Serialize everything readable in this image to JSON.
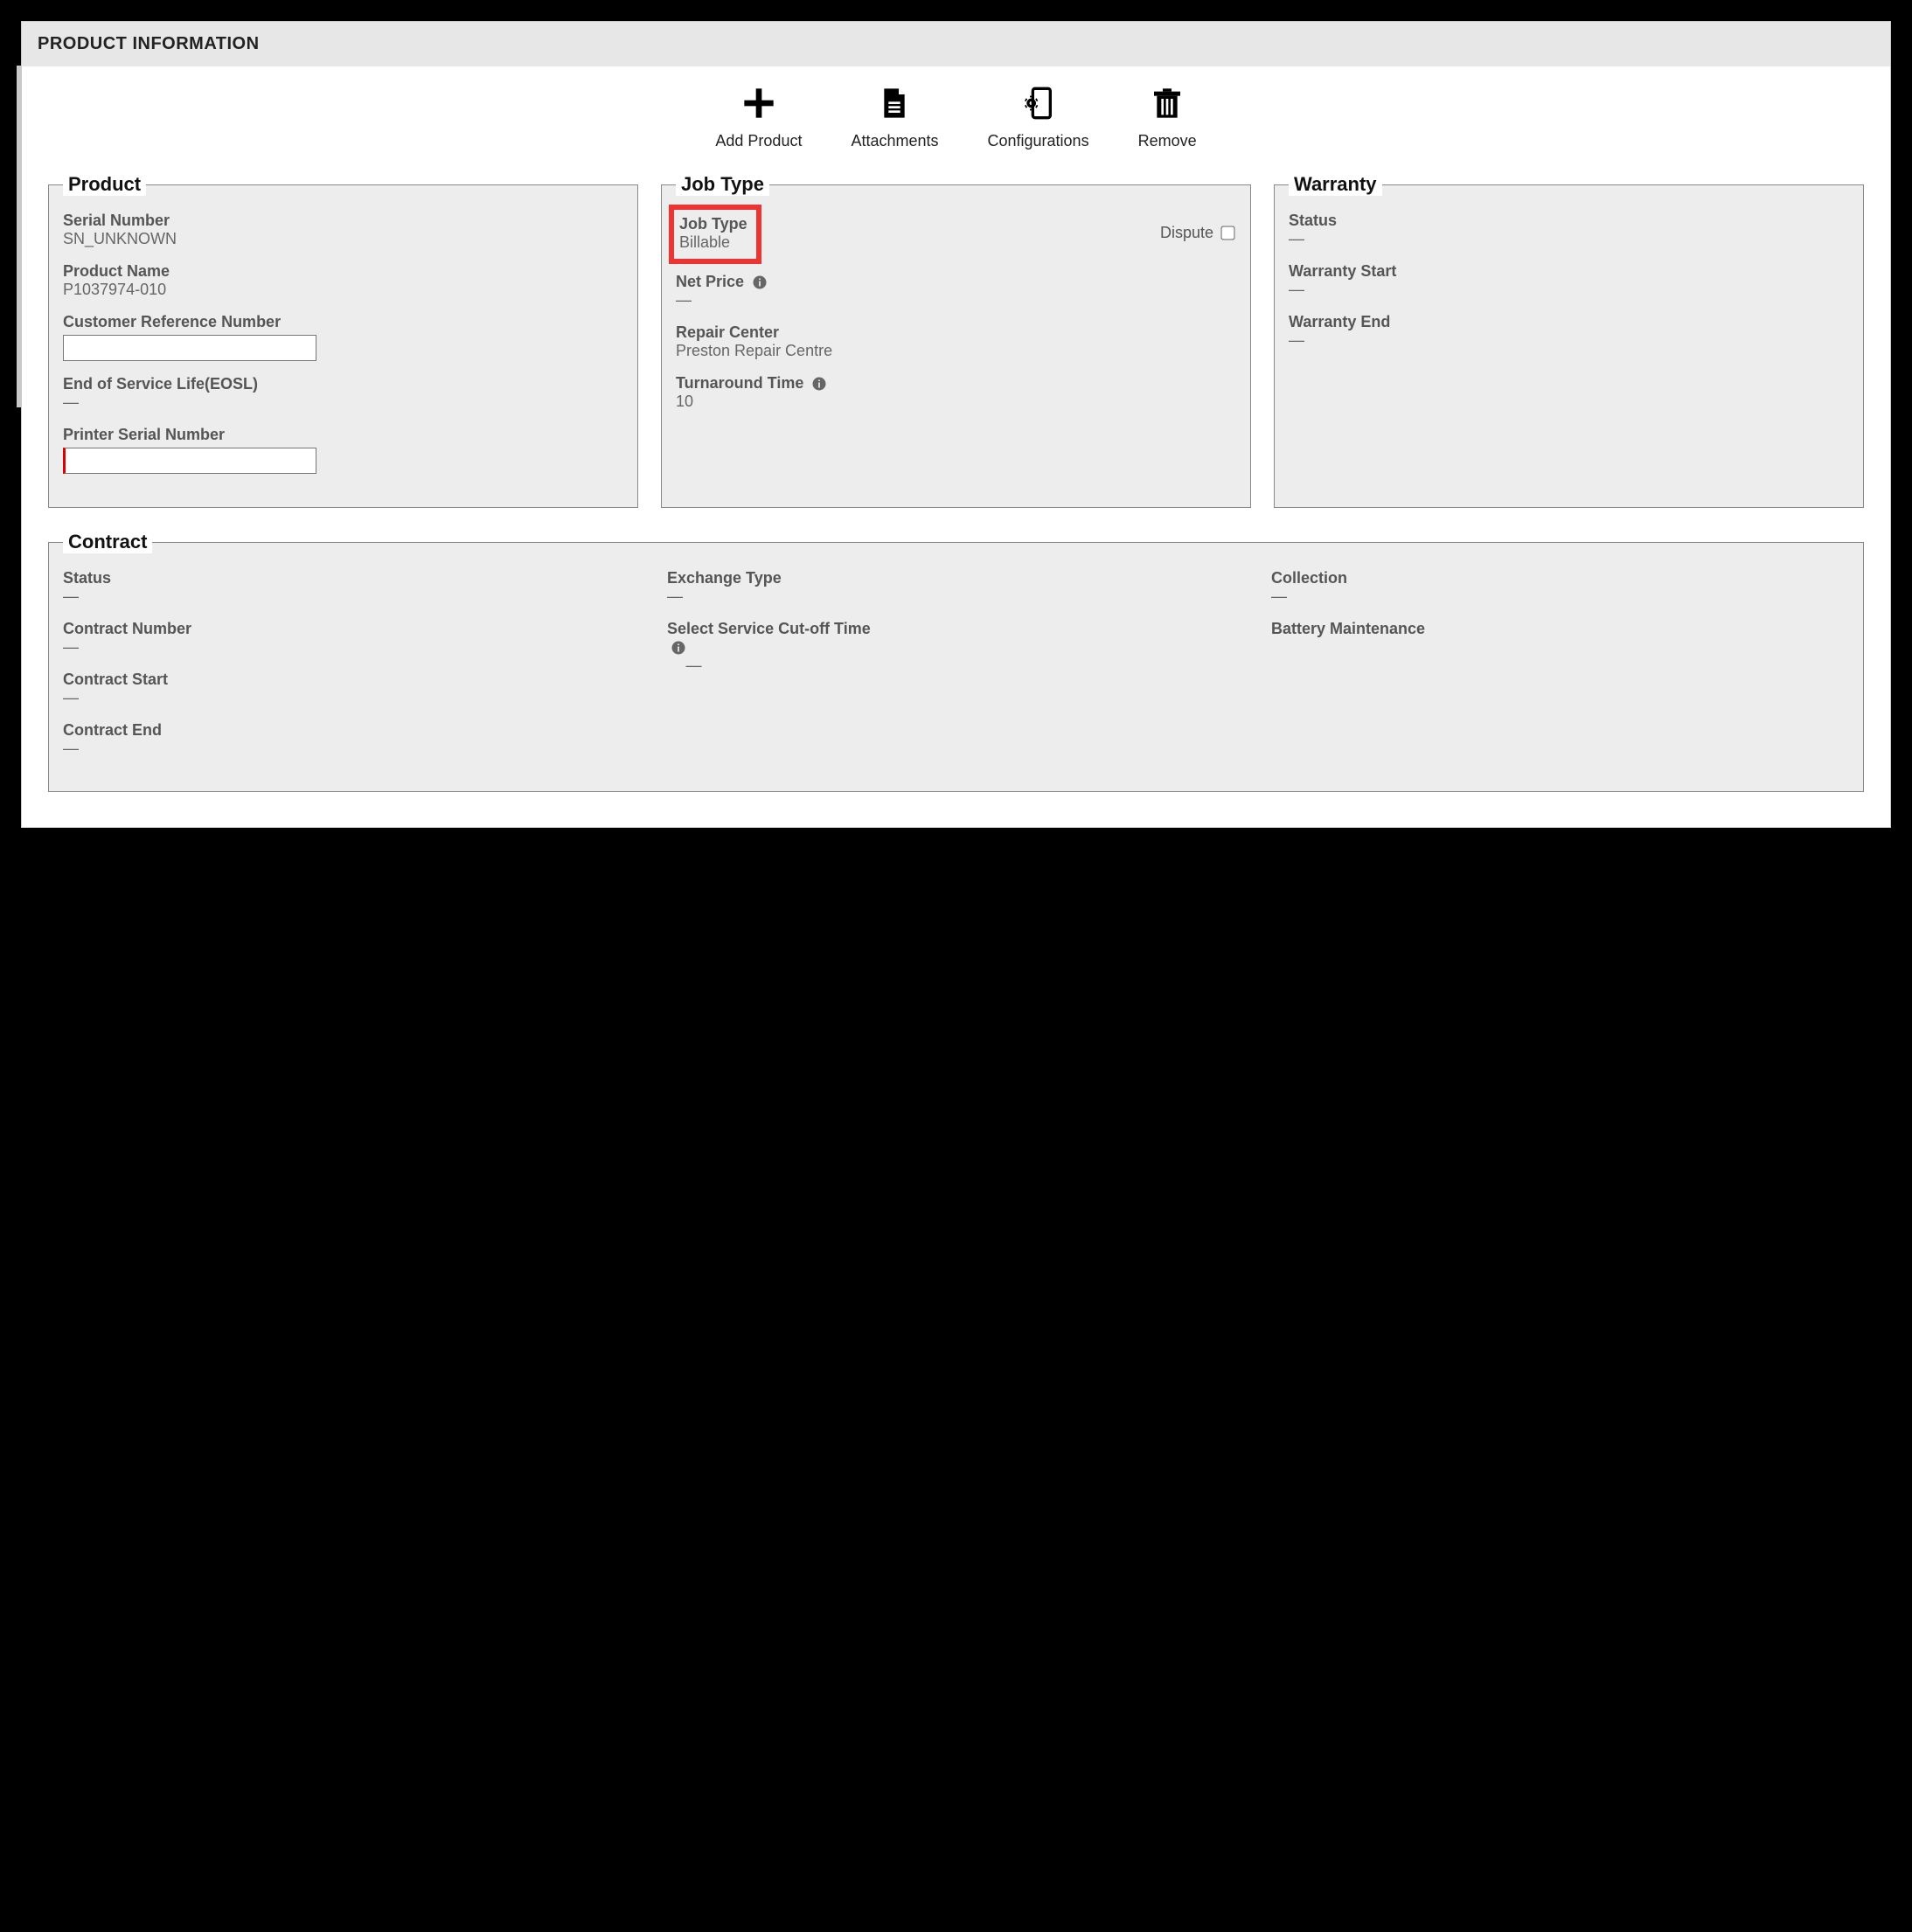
{
  "header": {
    "title": "PRODUCT INFORMATION"
  },
  "toolbar": {
    "add_product": "Add Product",
    "attachments": "Attachments",
    "configurations": "Configurations",
    "remove": "Remove"
  },
  "product": {
    "legend": "Product",
    "serial_number_label": "Serial Number",
    "serial_number_value": "SN_UNKNOWN",
    "product_name_label": "Product Name",
    "product_name_value": "P1037974-010",
    "customer_ref_label": "Customer Reference Number",
    "customer_ref_value": "",
    "eosl_label": "End of Service Life(EOSL)",
    "eosl_value": "—",
    "printer_serial_label": "Printer Serial Number",
    "printer_serial_value": ""
  },
  "jobtype": {
    "legend": "Job Type",
    "job_type_label": "Job Type",
    "job_type_value": "Billable",
    "dispute_label": "Dispute",
    "dispute_checked": false,
    "net_price_label": "Net Price",
    "net_price_value": "—",
    "repair_center_label": "Repair Center",
    "repair_center_value": "Preston Repair Centre",
    "turnaround_label": "Turnaround Time",
    "turnaround_value": "10"
  },
  "warranty": {
    "legend": "Warranty",
    "status_label": "Status",
    "status_value": "—",
    "start_label": "Warranty Start",
    "start_value": "—",
    "end_label": "Warranty End",
    "end_value": "—"
  },
  "contract": {
    "legend": "Contract",
    "status_label": "Status",
    "status_value": "—",
    "number_label": "Contract Number",
    "number_value": "—",
    "start_label": "Contract Start",
    "start_value": "—",
    "end_label": "Contract End",
    "end_value": "—",
    "exchange_type_label": "Exchange Type",
    "exchange_type_value": "—",
    "cutoff_label": "Select Service Cut-off Time",
    "cutoff_value": "—",
    "collection_label": "Collection",
    "collection_value": "—",
    "battery_label": "Battery Maintenance",
    "battery_value": ""
  }
}
